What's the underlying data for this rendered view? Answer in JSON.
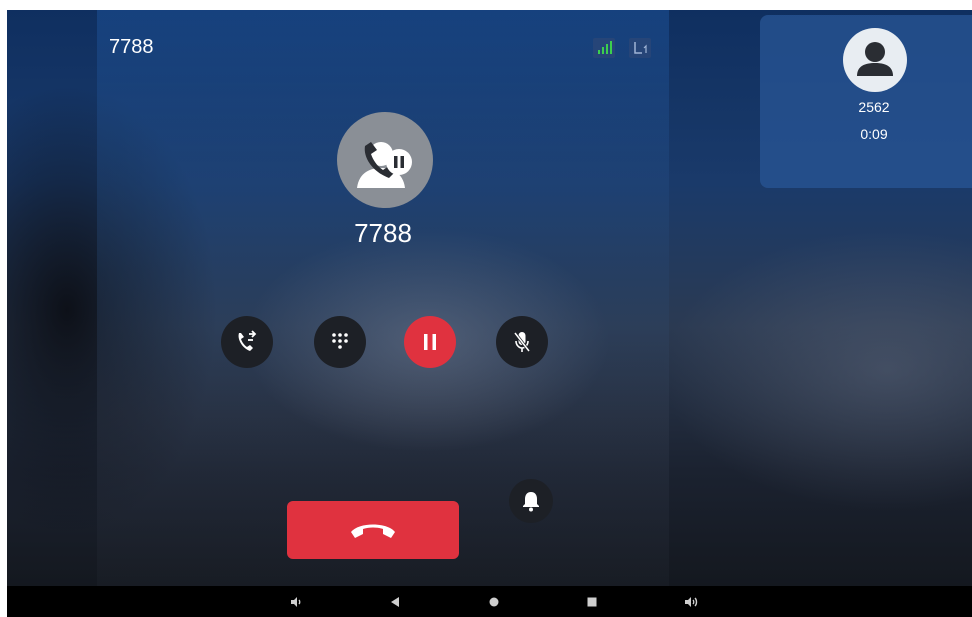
{
  "call": {
    "header_number": "7788",
    "caller_number": "7788",
    "status_icons": [
      "signal-strength-icon",
      "line-1-icon"
    ]
  },
  "controls": [
    {
      "name": "transfer",
      "icon": "call-transfer-icon",
      "color": "#1d2026"
    },
    {
      "name": "dialpad",
      "icon": "dialpad-icon",
      "color": "#1d2026"
    },
    {
      "name": "hold",
      "icon": "pause-icon",
      "color": "#e0323f"
    },
    {
      "name": "mute",
      "icon": "mic-off-icon",
      "color": "#1d2026"
    }
  ],
  "end_call": {
    "icon": "hang-up-icon",
    "color": "#e0323f"
  },
  "notification": {
    "icon": "bell-icon"
  },
  "other_call": {
    "number": "2562",
    "duration": "0:09",
    "icon": "person-icon"
  },
  "navbar": {
    "icons": [
      "volume-down-icon",
      "back-icon",
      "home-icon",
      "recents-icon",
      "volume-up-icon"
    ]
  },
  "colors": {
    "accent_red": "#e0323f",
    "button_dark": "#1d2026",
    "panel_blue": "#1c5096"
  }
}
